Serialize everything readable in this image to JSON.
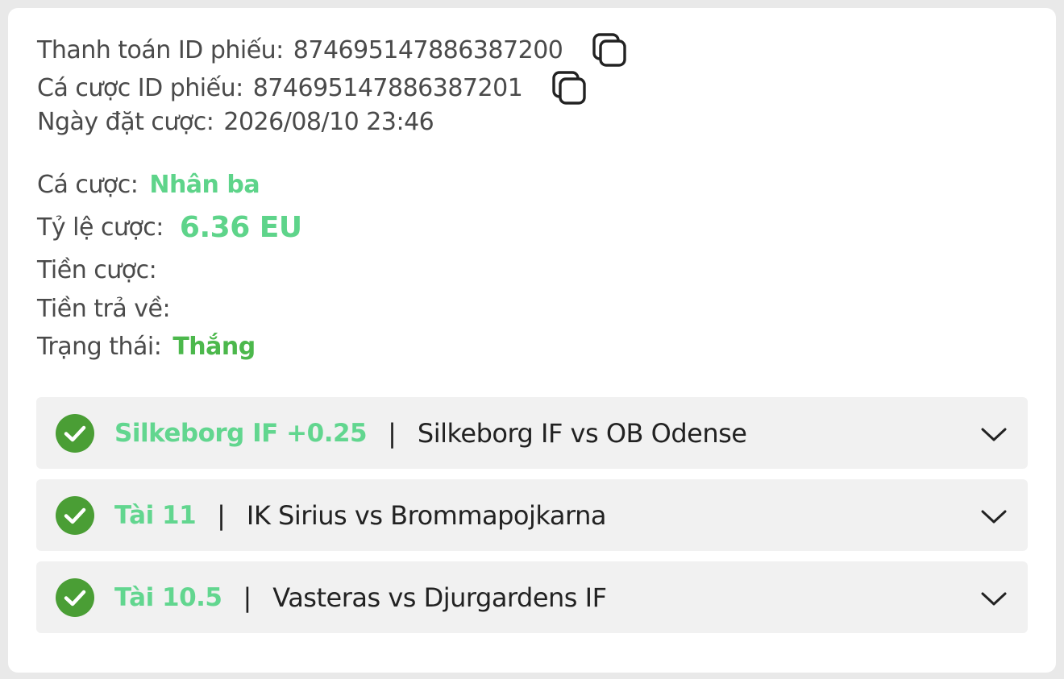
{
  "ticket": {
    "payment_id_label": "Thanh toán ID phiếu:",
    "payment_id": "874695147886387200",
    "bet_id_label": "Cá cược ID phiếu:",
    "bet_id": "874695147886387201",
    "date_label": "Ngày đặt cược:",
    "date": "2026/08/10 23:46"
  },
  "details": {
    "bet_type_label": "Cá cược:",
    "bet_type": "Nhân ba",
    "odds_label": "Tỷ lệ cược:",
    "odds": "6.36 EU",
    "stake_label": "Tiền cược:",
    "stake": "",
    "payout_label": "Tiền trả về:",
    "payout": "",
    "status_label": "Trạng thái:",
    "status": "Thắng"
  },
  "selections": [
    {
      "pick": "Silkeborg IF +0.25",
      "separator": "|",
      "match": "Silkeborg IF vs OB Odense"
    },
    {
      "pick": "Tài 11",
      "separator": "|",
      "match": "IK Sirius vs Brommapojkarna"
    },
    {
      "pick": "Tài 10.5",
      "separator": "|",
      "match": "Vasteras vs Djurgardens IF"
    }
  ],
  "colors": {
    "accent_green": "#5ed48a",
    "status_green": "#4cb84c",
    "check_green": "#4a9e35"
  },
  "icons": {
    "copy": "copy-icon",
    "check": "check-circle-icon",
    "expand": "chevron-down-icon"
  }
}
